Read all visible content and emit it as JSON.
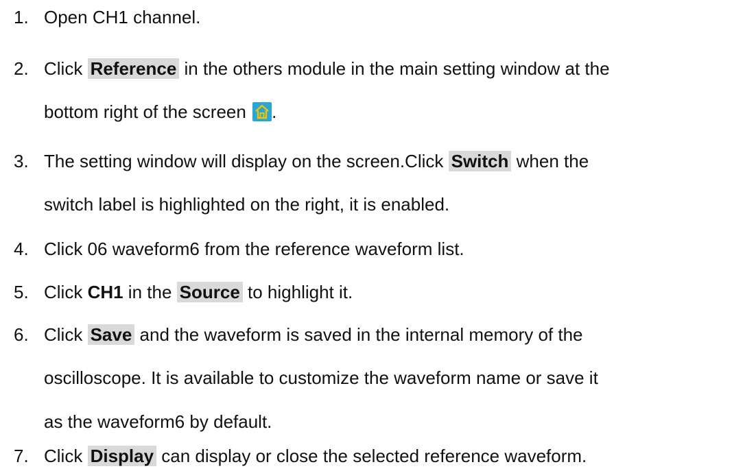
{
  "steps": [
    {
      "num": "1.",
      "a": "Open CH1 channel."
    },
    {
      "num": "2.",
      "a": "Click ",
      "hl": "Reference",
      "b": " in the others module in the main setting window at the",
      "c": "bottom right of the screen",
      "d": "."
    },
    {
      "num": "3.",
      "a": "The setting window will display on the screen.Click ",
      "hl": "Switch",
      "b": " when the",
      "c": "switch label is highlighted on the right, it is enabled."
    },
    {
      "num": "4.",
      "a": "Click 06 waveform6 from the reference waveform list."
    },
    {
      "num": "5.",
      "a": "Click ",
      "bold": "CH1",
      "b": " in the ",
      "hl": "Source",
      "c": " to highlight it."
    },
    {
      "num": "6.",
      "a": "Click ",
      "hl": "Save",
      "b": " and the waveform is saved in the internal memory of the",
      "c": "oscilloscope. It is available to customize the waveform name or save it",
      "d": "as the waveform6 by default."
    },
    {
      "num": "7.",
      "a": "Click ",
      "hl": "Display",
      "b": " can display or close the selected reference waveform."
    }
  ],
  "colors": {
    "highlight_bg": "#d9d9d9",
    "icon_bg": "#2aa6d4",
    "icon_fg": "#f2c200"
  },
  "icons": {
    "home": "home-icon"
  }
}
